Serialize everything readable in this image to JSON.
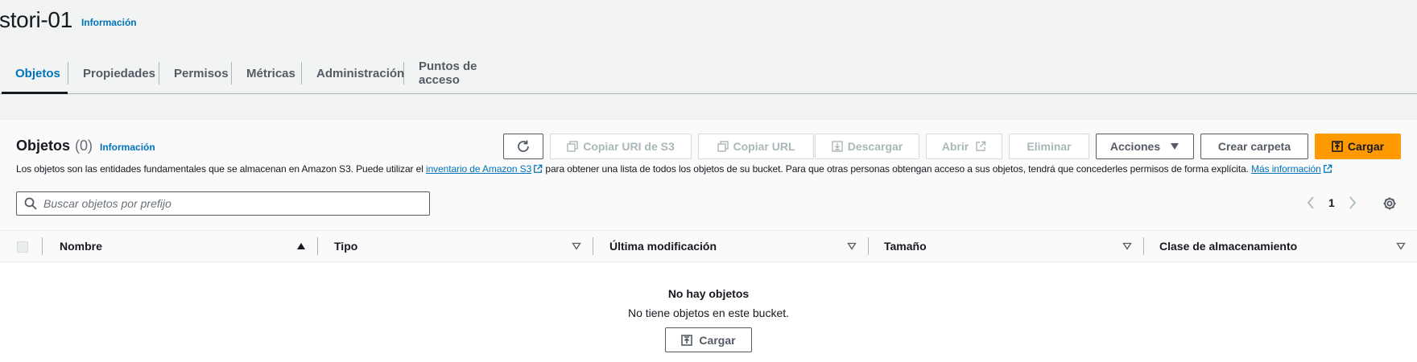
{
  "header": {
    "title": "stori-01",
    "info": "Información"
  },
  "tabs": [
    {
      "label": "Objetos",
      "active": true
    },
    {
      "label": "Propiedades"
    },
    {
      "label": "Permisos"
    },
    {
      "label": "Métricas"
    },
    {
      "label": "Administración"
    },
    {
      "label": "Puntos de acceso"
    }
  ],
  "objects": {
    "title": "Objetos",
    "count": "(0)",
    "info": "Información",
    "description": {
      "before": "Los objetos son las entidades fundamentales que se almacenan en Amazon S3. Puede utilizar el ",
      "link1": "inventario de Amazon S3",
      "middle": " para obtener una lista de todos los objetos de su bucket. Para que otras personas obtengan acceso a sus objetos, tendrá que concederles permisos de forma explícita. ",
      "link2": "Más información"
    },
    "toolbar": {
      "copy_uri": "Copiar URI de S3",
      "copy_url": "Copiar URL",
      "download": "Descargar",
      "open": "Abrir",
      "delete": "Eliminar",
      "actions": "Acciones",
      "create_folder": "Crear carpeta",
      "upload": "Cargar"
    },
    "search": {
      "placeholder": "Buscar objetos por prefijo",
      "value": ""
    },
    "pagination": {
      "page": "1"
    },
    "columns": [
      "Nombre",
      "Tipo",
      "Última modificación",
      "Tamaño",
      "Clase de almacenamiento"
    ],
    "empty": {
      "title": "No hay objetos",
      "subtitle": "No tiene objetos en este bucket.",
      "button": "Cargar"
    }
  },
  "colors": {
    "accent_link": "#0073bb",
    "primary_button": "#ff9900",
    "text": "#16191f",
    "disabled_text": "#aab7b8"
  },
  "icons": [
    "refresh-icon",
    "copy-icon",
    "download-icon",
    "external-link-icon",
    "caret-down-icon",
    "upload-icon",
    "search-icon",
    "chevron-left-icon",
    "chevron-right-icon",
    "gear-icon",
    "sort-ascending-icon",
    "sort-descending-icon"
  ]
}
